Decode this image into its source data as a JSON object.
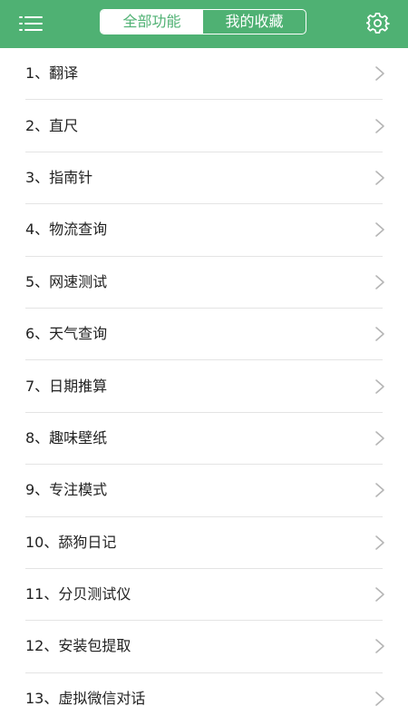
{
  "header": {
    "tabs": [
      {
        "label": "全部功能",
        "active": true
      },
      {
        "label": "我的收藏",
        "active": false
      }
    ]
  },
  "icons": {
    "menu": "menu-icon",
    "settings": "gear-icon",
    "row_arrow": "chevron-right-icon"
  },
  "colors": {
    "accent": "#4fb173",
    "divider": "#e4e4e4",
    "text": "#222222",
    "chevron": "#b5b5b5"
  },
  "features": [
    {
      "label": "1、翻译"
    },
    {
      "label": "2、直尺"
    },
    {
      "label": "3、指南针"
    },
    {
      "label": "4、物流查询"
    },
    {
      "label": "5、网速测试"
    },
    {
      "label": "6、天气查询"
    },
    {
      "label": "7、日期推算"
    },
    {
      "label": "8、趣味壁纸"
    },
    {
      "label": "9、专注模式"
    },
    {
      "label": "10、舔狗日记"
    },
    {
      "label": "11、分贝测试仪"
    },
    {
      "label": "12、安装包提取"
    },
    {
      "label": "13、虚拟微信对话"
    }
  ]
}
